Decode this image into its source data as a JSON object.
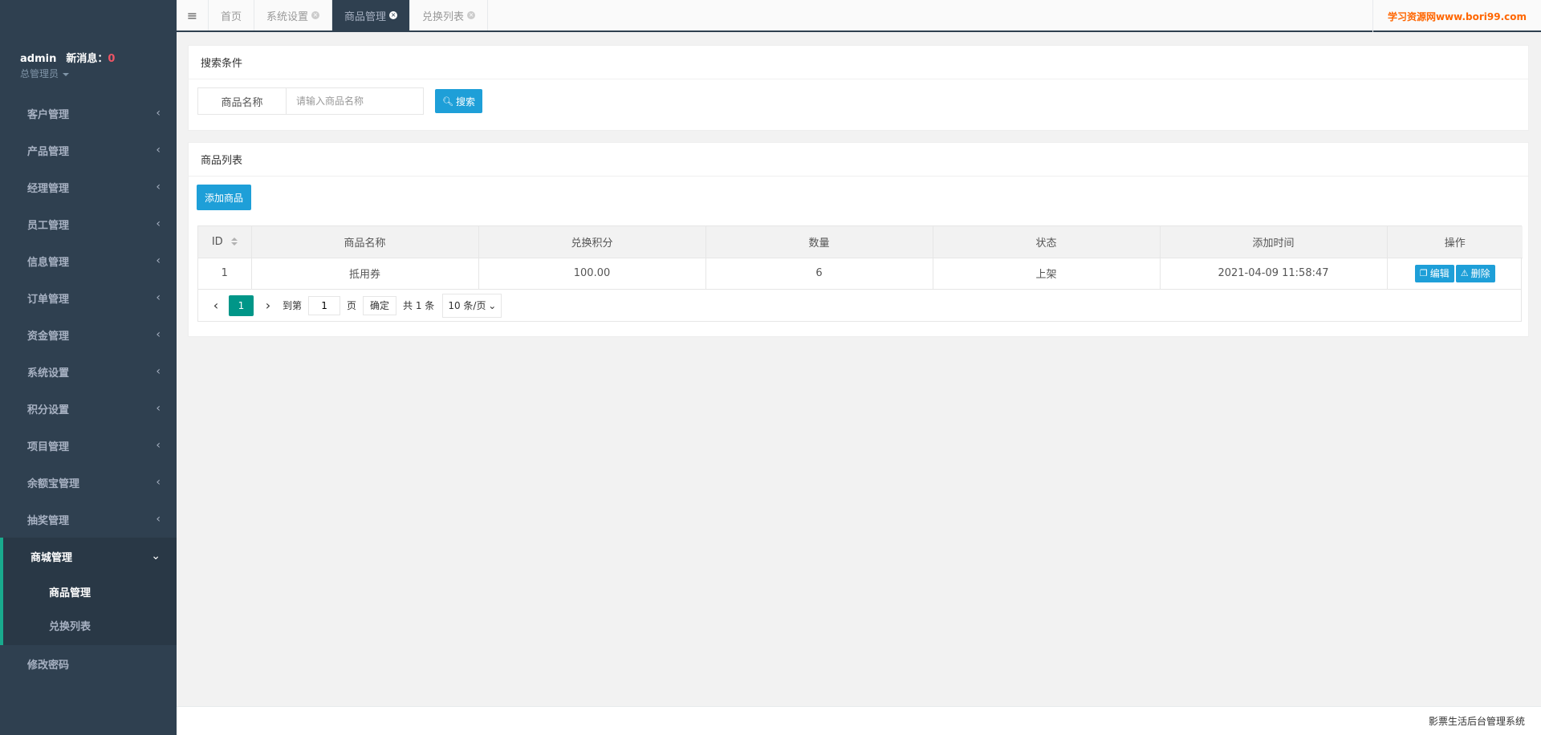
{
  "profile": {
    "username": "admin",
    "msg_label": "新消息：",
    "msg_count": "0",
    "role": "总管理员"
  },
  "sidebar": {
    "items": [
      {
        "label": "客户管理"
      },
      {
        "label": "产品管理"
      },
      {
        "label": "经理管理"
      },
      {
        "label": "员工管理"
      },
      {
        "label": "信息管理"
      },
      {
        "label": "订单管理"
      },
      {
        "label": "资金管理"
      },
      {
        "label": "系统设置"
      },
      {
        "label": "积分设置"
      },
      {
        "label": "项目管理"
      },
      {
        "label": "余额宝管理"
      },
      {
        "label": "抽奖管理"
      }
    ],
    "active_group": {
      "label": "商城管理",
      "children": [
        "商品管理",
        "兑换列表"
      ]
    },
    "last_item": "修改密码"
  },
  "tabs": [
    {
      "label": "首页"
    },
    {
      "label": "系统设置"
    },
    {
      "label": "商品管理"
    },
    {
      "label": "兑换列表"
    }
  ],
  "brand_text": "学习资源网www.bori99.com",
  "search": {
    "title": "搜索条件",
    "field_label": "商品名称",
    "placeholder": "请输入商品名称",
    "button": "搜索"
  },
  "list": {
    "title": "商品列表",
    "add_button": "添加商品",
    "columns": [
      "ID",
      "商品名称",
      "兑换积分",
      "数量",
      "状态",
      "添加时间",
      "操作"
    ],
    "rows": [
      {
        "id": "1",
        "name": "抵用券",
        "points": "100.00",
        "qty": "6",
        "status": "上架",
        "time": "2021-04-09 11:58:47",
        "edit": "编辑",
        "delete": "删除"
      }
    ]
  },
  "pager": {
    "current": "1",
    "goto_label": "到第",
    "goto_value": "1",
    "page_unit": "页",
    "confirm": "确定",
    "total": "共 1 条",
    "page_size": "10 条/页"
  },
  "footer": "影票生活后台管理系统"
}
